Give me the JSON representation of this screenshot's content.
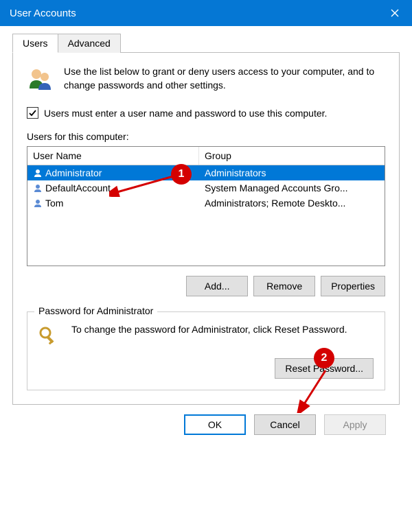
{
  "window": {
    "title": "User Accounts"
  },
  "tabs": {
    "users": "Users",
    "advanced": "Advanced"
  },
  "intro": "Use the list below to grant or deny users access to your computer, and to change passwords and other settings.",
  "checkbox": {
    "checked": true,
    "label": "Users must enter a user name and password to use this computer."
  },
  "list": {
    "label": "Users for this computer:",
    "columns": {
      "name": "User Name",
      "group": "Group"
    },
    "rows": [
      {
        "name": "Administrator",
        "group": "Administrators",
        "selected": true
      },
      {
        "name": "DefaultAccount",
        "group": "System Managed Accounts Gro...",
        "selected": false
      },
      {
        "name": "Tom",
        "group": "Administrators; Remote Deskto...",
        "selected": false
      }
    ]
  },
  "buttons": {
    "add": "Add...",
    "remove": "Remove",
    "properties": "Properties",
    "reset_password": "Reset Password...",
    "ok": "OK",
    "cancel": "Cancel",
    "apply": "Apply"
  },
  "password_box": {
    "legend": "Password for Administrator",
    "text": "To change the password for Administrator, click Reset Password."
  },
  "annotations": {
    "badge1": "1",
    "badge2": "2"
  }
}
